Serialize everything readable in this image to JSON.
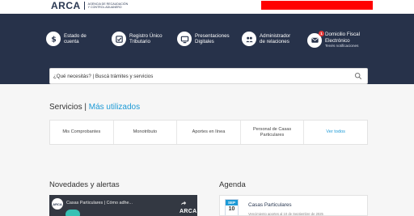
{
  "header": {
    "logo_word": "ARCA",
    "logo_sub": "Agencia de recaudación y control aduanero"
  },
  "quick_links": [
    {
      "icon": "dollar-icon",
      "line1": "Estado de",
      "line2": "cuenta"
    },
    {
      "icon": "check-box-icon",
      "line1": "Registro Único",
      "line2": "Tributario"
    },
    {
      "icon": "monitor-icon",
      "line1": "Presentaciones",
      "line2": "Digitales"
    },
    {
      "icon": "people-icon",
      "line1": "Administrador",
      "line2": "de relaciones"
    },
    {
      "icon": "mail-icon",
      "line1": "Domicilio Fiscal",
      "line2": "Electrónico",
      "sub": "Tenés notificaciones",
      "badge": "1"
    }
  ],
  "search": {
    "placeholder": "¿Qué necesitás? | Buscá trámites y servicios"
  },
  "services": {
    "title": "Servicios",
    "separator": "|",
    "title_highlight": "Más utilizados",
    "items": [
      {
        "line1": "Mis Comprobantes",
        "line2": ""
      },
      {
        "line1": "Monotributo",
        "line2": ""
      },
      {
        "line1": "Aportes en línea",
        "line2": ""
      },
      {
        "line1": "Personal de Casas",
        "line2": "Particulares"
      },
      {
        "line1": "Ver todos",
        "line2": ""
      }
    ]
  },
  "novedades": {
    "title": "Novedades y alertas",
    "video_logo": "ARCA",
    "video_title": "Casas Particulares | Cómo adhe...",
    "video_watermark": "ARCA"
  },
  "agenda": {
    "title": "Agenda",
    "month": "SEP",
    "day": "10",
    "event_title": "Casas Particulares",
    "event_sub": "Vencimiento aportes al 10 de Septiembre de 2025"
  },
  "colors": {
    "hero": "#27324a",
    "accent": "#1d9ad6",
    "alert": "#ff0000"
  }
}
